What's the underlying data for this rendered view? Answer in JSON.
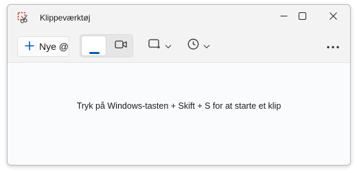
{
  "window": {
    "title": "Klippeværktøj",
    "controls": {
      "minimize_icon": "minimize-icon",
      "maximize_icon": "maximize-icon",
      "close_icon": "close-icon"
    }
  },
  "toolbar": {
    "new_label": "Nye @",
    "new_icon": "plus-icon",
    "mode": {
      "selected": "screenshot",
      "options": [
        "screenshot",
        "video"
      ]
    },
    "shape_icon": "rectangle-snip-icon",
    "timer_icon": "clock-icon",
    "more_icon": "more-icon"
  },
  "content": {
    "hint": "Tryk på Windows-tasten + Skift + S for at starte et klip"
  },
  "colors": {
    "accent": "#005fb8",
    "window_bg": "#f3f3f3",
    "content_bg": "#fafbfc"
  }
}
